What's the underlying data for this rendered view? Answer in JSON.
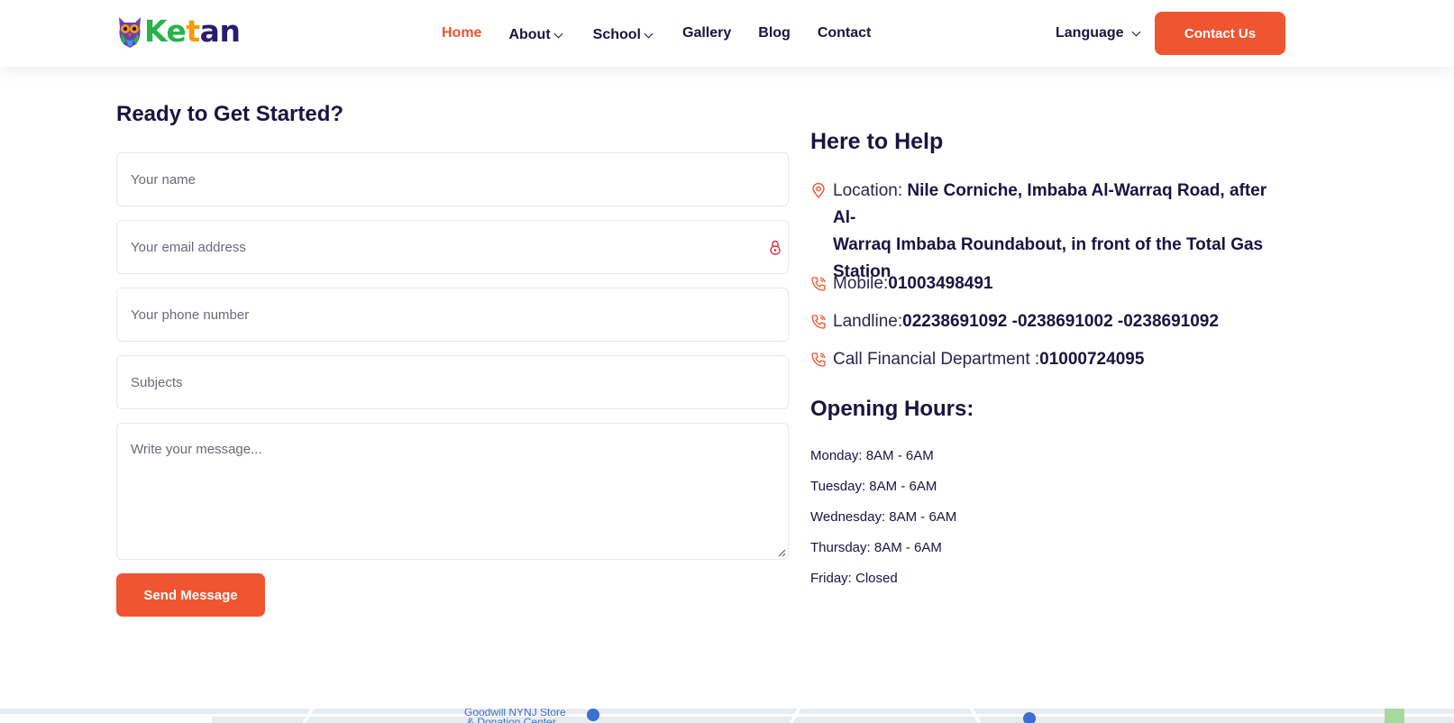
{
  "header": {
    "logo_text": [
      "K",
      "e",
      "t",
      "a",
      "n"
    ],
    "nav": [
      {
        "label": "Home",
        "active": true,
        "dropdown": false
      },
      {
        "label": "About",
        "active": false,
        "dropdown": true
      },
      {
        "label": "School",
        "active": false,
        "dropdown": true
      },
      {
        "label": "Gallery",
        "active": false,
        "dropdown": false
      },
      {
        "label": "Blog",
        "active": false,
        "dropdown": false
      },
      {
        "label": "Contact",
        "active": false,
        "dropdown": false
      }
    ],
    "language_label": "Language",
    "cta_label": "Contact Us"
  },
  "form": {
    "title": "Ready to Get Started?",
    "name_placeholder": "Your name",
    "email_placeholder": "Your email address",
    "phone_placeholder": "Your phone number",
    "subjects_placeholder": "Subjects",
    "message_placeholder": "Write your message...",
    "send_label": "Send Message"
  },
  "help": {
    "title": "Here to Help",
    "location_label": "Location: ",
    "location_value_line1": "Nile Corniche, Imbaba Al-Warraq Road, after Al-",
    "location_value_line2": "Warraq Imbaba Roundabout, in front of the Total Gas",
    "location_value_line3": "Station",
    "mobile_label": "Mobile: ",
    "mobile_value": "01003498491",
    "landline_label": "Landline: ",
    "landline_value": "02238691092 -0238691002 -0238691092",
    "finance_label": "Call Financial Department : ",
    "finance_value": "01000724095"
  },
  "hours": {
    "title": "Opening Hours:",
    "items": [
      "Monday: 8AM - 6AM",
      "Tuesday: 8AM - 6AM",
      "Wednesday: 8AM - 6AM",
      "Thursday: 8AM - 6AM",
      "Friday: Closed"
    ]
  },
  "map": {
    "place_label": "Goodwill NYNJ Store",
    "place_label_2": "& Donation Center"
  },
  "colors": {
    "accent": "#ef5530",
    "text_dark": "#1c1340",
    "logo_green": "#27b34a",
    "logo_orange": "#f59a0c",
    "logo_navy": "#2b1d6b"
  },
  "icons": [
    "owl-logo-icon",
    "chevron-down-icon",
    "lock-icon",
    "location-pin-icon",
    "phone-icon"
  ]
}
